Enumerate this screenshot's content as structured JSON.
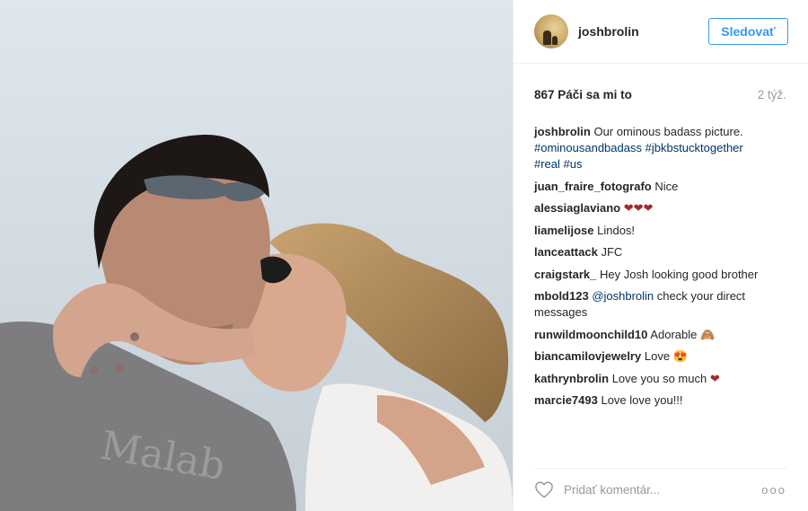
{
  "header": {
    "username": "joshbrolin",
    "follow_label": "Sledovať"
  },
  "stats": {
    "likes": "867 Páči sa mi to",
    "time": "2 týž."
  },
  "caption": {
    "user": "joshbrolin",
    "text": "Our ominous badass picture.",
    "tags": [
      "#ominousandbadass",
      "#jbkbstucktogether",
      "#real",
      "#us"
    ]
  },
  "comments": [
    {
      "user": "juan_fraire_fotografo",
      "text": "Nice"
    },
    {
      "user": "alessiaglaviano",
      "text": "",
      "emoji": "❤❤❤"
    },
    {
      "user": "liamelijose",
      "text": "Lindos!"
    },
    {
      "user": "lanceattack",
      "text": "JFC"
    },
    {
      "user": "craigstark_",
      "text": "Hey Josh looking good brother"
    },
    {
      "user": "mbold123",
      "mention": "@joshbrolin",
      "text": "check your direct messages"
    },
    {
      "user": "runwildmoonchild10",
      "text": "Adorable",
      "emoji": "🙈"
    },
    {
      "user": "biancamilovjewelry",
      "text": "Love",
      "emoji": "😍"
    },
    {
      "user": "kathrynbrolin",
      "text": "Love you so much",
      "emoji": "❤"
    },
    {
      "user": "marcie7493",
      "text": "Love love you!!!"
    }
  ],
  "footer": {
    "add_comment_placeholder": "Pridať komentár...",
    "like_icon": "heart-outline-icon",
    "more_icon": "more-options-icon"
  },
  "photo": {
    "shirt_text": "Malab"
  },
  "colors": {
    "link": "#003569",
    "heart": "#a4282c",
    "follow": "#3897f0"
  }
}
